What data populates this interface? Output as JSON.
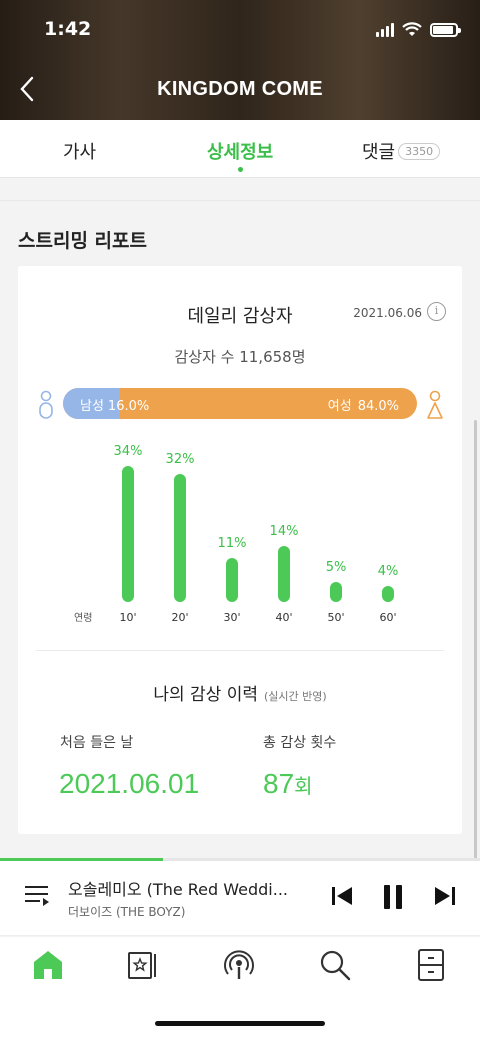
{
  "status_bar": {
    "time": "1:42"
  },
  "header": {
    "title": "KINGDOM COME"
  },
  "tabs": [
    {
      "label": "가사"
    },
    {
      "label": "상세정보",
      "active": true
    },
    {
      "label": "댓글",
      "badge": "3350"
    }
  ],
  "section_title": "스트리밍 리포트",
  "daily": {
    "title": "데일리 감상자",
    "date": "2021.06.06",
    "listeners_text": "감상자 수 11,658명",
    "male_label": "남성",
    "male_pct": "16.0%",
    "male_fraction": 0.16,
    "female_label": "여성",
    "female_pct": "84.0%"
  },
  "chart_data": {
    "type": "bar",
    "xlabel": "연령",
    "categories": [
      "10'",
      "20'",
      "30'",
      "40'",
      "50'",
      "60'"
    ],
    "values": [
      34,
      32,
      11,
      14,
      5,
      4
    ],
    "value_labels": [
      "34%",
      "32%",
      "11%",
      "14%",
      "5%",
      "4%"
    ],
    "ylim": [
      0,
      34
    ]
  },
  "history": {
    "title": "나의 감상 이력",
    "subtitle": "(실시간 반영)",
    "first_label": "처음 들은 날",
    "first_value": "2021.06.01",
    "total_label": "총 감상 횟수",
    "total_value": "87",
    "total_unit": "회"
  },
  "player": {
    "title": "오솔레미오 (The Red Weddi...",
    "artist": "더보이즈 (THE BOYZ)",
    "progress": 0.34
  },
  "colors": {
    "accent": "#4cc957",
    "male": "#97b6e8",
    "female": "#eea24b"
  },
  "nav": [
    "home-icon",
    "library-icon",
    "podcast-icon",
    "search-icon",
    "storage-icon"
  ]
}
